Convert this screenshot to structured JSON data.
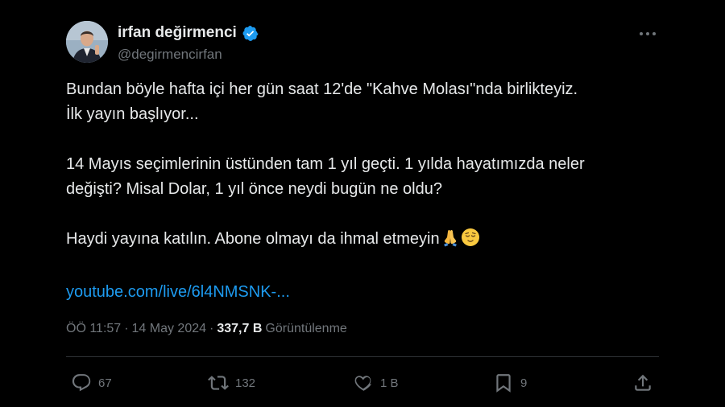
{
  "author": {
    "display_name": "irfan değirmenci",
    "handle": "@degirmencirfan",
    "verified_icon": "verified-badge-icon",
    "verified_color": "#1d9bf0"
  },
  "tweet": {
    "paragraphs": [
      "Bundan böyle hafta içi her gün saat 12'de \"Kahve Molası\"nda birlikteyiz.\nİlk yayın başlıyor...",
      "14 Mayıs seçimlerinin üstünden tam 1 yıl geçti. 1 yılda hayatımızda neler\ndeğişti? Misal Dolar, 1 yıl önce neydi bugün ne oldu?"
    ],
    "last_paragraph": "Haydi yayına katılın. Abone olmayı da ihmal etmeyin",
    "emojis": [
      "folded-hands-emoji",
      "relieved-face-emoji"
    ],
    "link": "youtube.com/live/6l4NMSNK-..."
  },
  "meta": {
    "time": "ÖÖ 11:57",
    "separator": "·",
    "date": "14 May 2024",
    "views_count": "337,7 B",
    "views_label": "Görüntülenme"
  },
  "actions": {
    "reply_icon": "reply-icon",
    "reply_count": "67",
    "retweet_icon": "retweet-icon",
    "retweet_count": "132",
    "like_icon": "heart-icon",
    "like_count": "1 B",
    "bookmark_icon": "bookmark-icon",
    "bookmark_count": "9",
    "share_icon": "share-icon"
  },
  "colors": {
    "background": "#000000",
    "text": "#e7e9ea",
    "secondary_text": "#71767b",
    "link": "#1d9bf0",
    "divider": "#2f3336"
  }
}
